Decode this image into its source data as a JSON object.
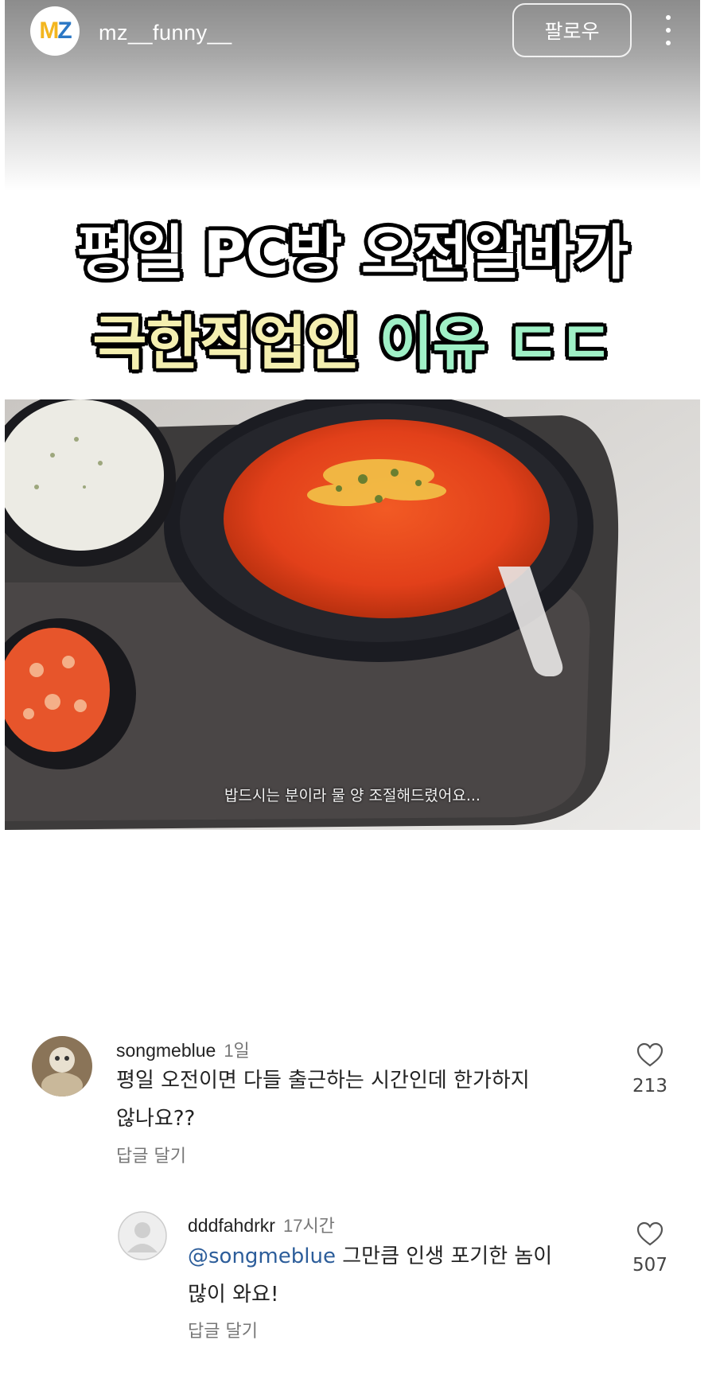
{
  "post": {
    "account": {
      "logo_text": "MZ",
      "username": "mz__funny__"
    },
    "follow_label": "팔로우",
    "menu_icon": "more-vertical-icon",
    "title_line1": "평일 PC방 오전알바가",
    "title_line2_part1": "극한직업인",
    "title_line2_part2": "이유 ㄷㄷ",
    "caption": "밥드시는 분이라 물 양 조절해드렸어요...",
    "colors": {
      "title_white": "#ffffff",
      "title_yellow": "#f4efb0",
      "title_mint": "#9ff0c6",
      "soup": "#e8421a"
    }
  },
  "comments": [
    {
      "username": "songmeblue",
      "time": "1일",
      "text_line1": "평일 오전이면 다들 출근하는 시간인데 한가하지",
      "text_line2": "않나요??",
      "reply_label": "답글 달기",
      "like_count": "213",
      "like_icon": "heart-outline-icon"
    },
    {
      "username": "dddfahdrkr",
      "time": "17시간",
      "mention": "@songmeblue",
      "text_line1": " 그만큼 인생 포기한 놈이",
      "text_line2": "많이 와요!",
      "reply_label": "답글 달기",
      "like_count": "507",
      "like_icon": "heart-outline-icon"
    }
  ]
}
